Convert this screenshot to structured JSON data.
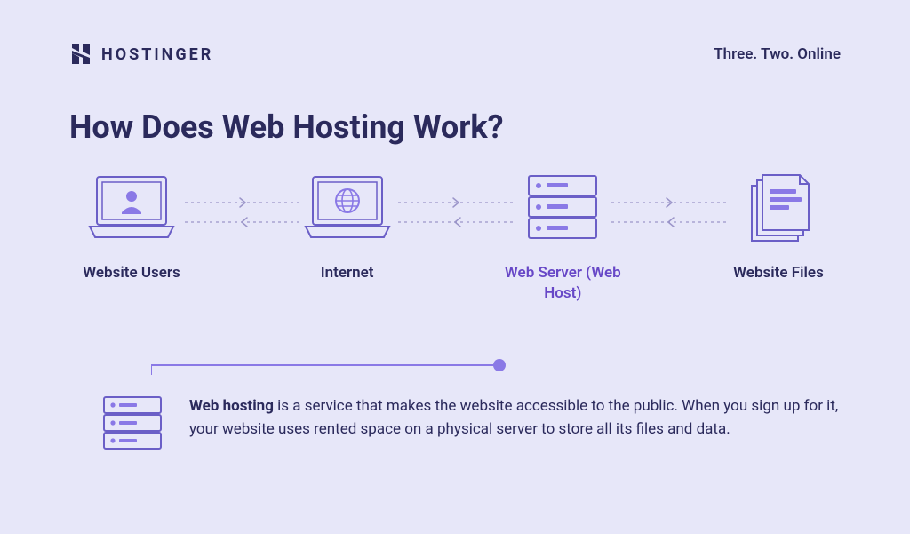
{
  "brand": {
    "name": "HOSTINGER",
    "tagline": "Three. Two. Online"
  },
  "title": "How Does Web Hosting Work?",
  "flow": {
    "nodes": [
      {
        "label": "Website Users",
        "icon": "laptop-user"
      },
      {
        "label": "Internet",
        "icon": "laptop-globe"
      },
      {
        "label": "Web Server (Web Host)",
        "icon": "server-stack",
        "accent": true
      },
      {
        "label": "Website Files",
        "icon": "files-stack"
      }
    ]
  },
  "description": {
    "bold": "Web hosting",
    "rest": " is a service that makes the website accessible to the public. When you sign up for it, your website uses rented space on a physical server to store all its files and data."
  }
}
